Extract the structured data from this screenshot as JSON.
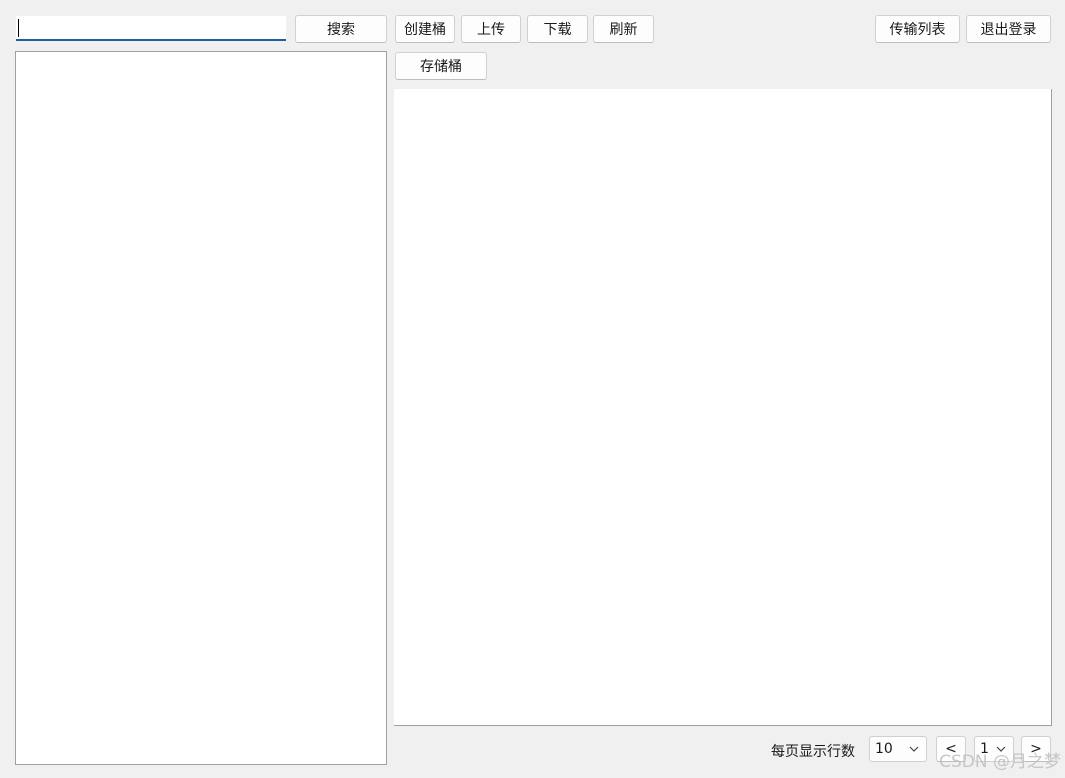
{
  "search": {
    "value": "",
    "button_label": "搜索"
  },
  "toolbar": {
    "create_bucket": "创建桶",
    "upload": "上传",
    "download": "下载",
    "refresh": "刷新",
    "transfer_list": "传输列表",
    "logout": "退出登录"
  },
  "breadcrumb": {
    "storage_bucket": "存储桶"
  },
  "pagination": {
    "rows_per_page_label": "每页显示行数",
    "rows_per_page_value": "10",
    "prev_label": "<",
    "page_value": "1",
    "next_label": ">"
  },
  "watermark": "CSDN @月之梦",
  "colors": {
    "background": "#f0f0f0",
    "input_underline": "#1f5f9f",
    "panel": "#ffffff"
  }
}
